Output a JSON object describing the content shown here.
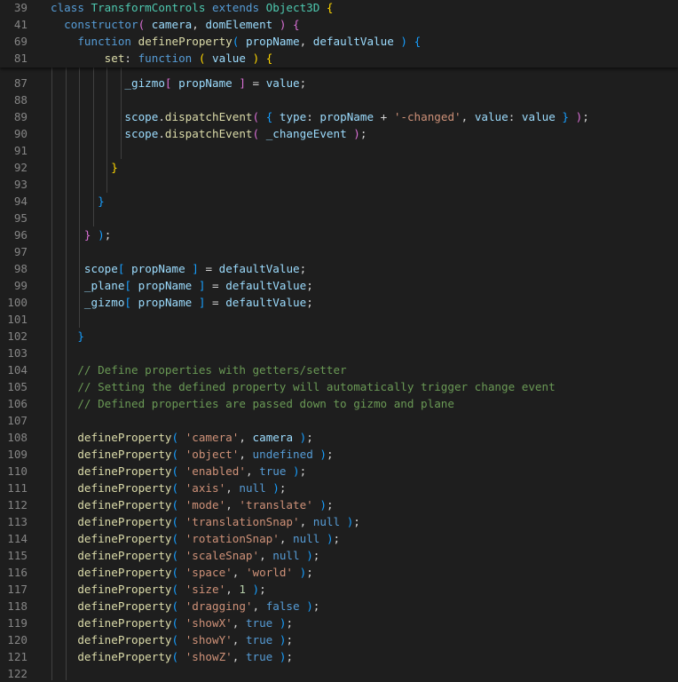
{
  "editor": {
    "sticky_lines": [
      {
        "num": "39",
        "tokens": [
          [
            "k",
            "class "
          ],
          [
            "cls",
            "TransformControls"
          ],
          [
            "k",
            " extends "
          ],
          [
            "cls",
            "Object3D"
          ],
          [
            "p",
            " "
          ],
          [
            "b1",
            "{"
          ]
        ]
      },
      {
        "num": "41",
        "tokens": [
          [
            "p",
            "  "
          ],
          [
            "k",
            "constructor"
          ],
          [
            "b2",
            "("
          ],
          [
            "p",
            " "
          ],
          [
            "v",
            "camera"
          ],
          [
            "p",
            ", "
          ],
          [
            "v",
            "domElement"
          ],
          [
            "p",
            " "
          ],
          [
            "b2",
            ")"
          ],
          [
            "p",
            " "
          ],
          [
            "b2",
            "{"
          ]
        ]
      },
      {
        "num": "69",
        "tokens": [
          [
            "p",
            "    "
          ],
          [
            "k",
            "function"
          ],
          [
            "p",
            " "
          ],
          [
            "fn",
            "defineProperty"
          ],
          [
            "b3",
            "("
          ],
          [
            "p",
            " "
          ],
          [
            "v",
            "propName"
          ],
          [
            "p",
            ", "
          ],
          [
            "v",
            "defaultValue"
          ],
          [
            "p",
            " "
          ],
          [
            "b3",
            ")"
          ],
          [
            "p",
            " "
          ],
          [
            "b3",
            "{"
          ]
        ]
      },
      {
        "num": "81",
        "tokens": [
          [
            "p",
            "        "
          ],
          [
            "fn",
            "set"
          ],
          [
            "p",
            ": "
          ],
          [
            "k",
            "function"
          ],
          [
            "p",
            " "
          ],
          [
            "b1",
            "("
          ],
          [
            "p",
            " "
          ],
          [
            "v",
            "value"
          ],
          [
            "p",
            " "
          ],
          [
            "b1",
            ")"
          ],
          [
            "p",
            " "
          ],
          [
            "b1",
            "{"
          ]
        ]
      }
    ],
    "lines": [
      {
        "num": "87",
        "tokens": [
          [
            "p",
            "           "
          ],
          [
            "v",
            "_gizmo"
          ],
          [
            "b2",
            "["
          ],
          [
            "p",
            " "
          ],
          [
            "v",
            "propName"
          ],
          [
            "p",
            " "
          ],
          [
            "b2",
            "]"
          ],
          [
            "p",
            " = "
          ],
          [
            "v",
            "value"
          ],
          [
            "p",
            ";"
          ]
        ]
      },
      {
        "num": "88",
        "tokens": []
      },
      {
        "num": "89",
        "tokens": [
          [
            "p",
            "           "
          ],
          [
            "v",
            "scope"
          ],
          [
            "p",
            "."
          ],
          [
            "fn",
            "dispatchEvent"
          ],
          [
            "b2",
            "("
          ],
          [
            "p",
            " "
          ],
          [
            "b3",
            "{"
          ],
          [
            "p",
            " "
          ],
          [
            "v",
            "type"
          ],
          [
            "p",
            ": "
          ],
          [
            "v",
            "propName"
          ],
          [
            "p",
            " + "
          ],
          [
            "s",
            "'-changed'"
          ],
          [
            "p",
            ", "
          ],
          [
            "v",
            "value"
          ],
          [
            "p",
            ": "
          ],
          [
            "v",
            "value"
          ],
          [
            "p",
            " "
          ],
          [
            "b3",
            "}"
          ],
          [
            "p",
            " "
          ],
          [
            "b2",
            ")"
          ],
          [
            "p",
            ";"
          ]
        ]
      },
      {
        "num": "90",
        "tokens": [
          [
            "p",
            "           "
          ],
          [
            "v",
            "scope"
          ],
          [
            "p",
            "."
          ],
          [
            "fn",
            "dispatchEvent"
          ],
          [
            "b2",
            "("
          ],
          [
            "p",
            " "
          ],
          [
            "v",
            "_changeEvent"
          ],
          [
            "p",
            " "
          ],
          [
            "b2",
            ")"
          ],
          [
            "p",
            ";"
          ]
        ]
      },
      {
        "num": "91",
        "tokens": []
      },
      {
        "num": "92",
        "tokens": [
          [
            "p",
            "         "
          ],
          [
            "b1",
            "}"
          ]
        ]
      },
      {
        "num": "93",
        "tokens": []
      },
      {
        "num": "94",
        "tokens": [
          [
            "p",
            "       "
          ],
          [
            "b3",
            "}"
          ]
        ]
      },
      {
        "num": "95",
        "tokens": []
      },
      {
        "num": "96",
        "tokens": [
          [
            "p",
            "     "
          ],
          [
            "b2",
            "}"
          ],
          [
            "p",
            " "
          ],
          [
            "b3",
            ")"
          ],
          [
            "p",
            ";"
          ]
        ]
      },
      {
        "num": "97",
        "tokens": []
      },
      {
        "num": "98",
        "tokens": [
          [
            "p",
            "     "
          ],
          [
            "v",
            "scope"
          ],
          [
            "b3",
            "["
          ],
          [
            "p",
            " "
          ],
          [
            "v",
            "propName"
          ],
          [
            "p",
            " "
          ],
          [
            "b3",
            "]"
          ],
          [
            "p",
            " = "
          ],
          [
            "v",
            "defaultValue"
          ],
          [
            "p",
            ";"
          ]
        ]
      },
      {
        "num": "99",
        "tokens": [
          [
            "p",
            "     "
          ],
          [
            "v",
            "_plane"
          ],
          [
            "b3",
            "["
          ],
          [
            "p",
            " "
          ],
          [
            "v",
            "propName"
          ],
          [
            "p",
            " "
          ],
          [
            "b3",
            "]"
          ],
          [
            "p",
            " = "
          ],
          [
            "v",
            "defaultValue"
          ],
          [
            "p",
            ";"
          ]
        ]
      },
      {
        "num": "100",
        "tokens": [
          [
            "p",
            "     "
          ],
          [
            "v",
            "_gizmo"
          ],
          [
            "b3",
            "["
          ],
          [
            "p",
            " "
          ],
          [
            "v",
            "propName"
          ],
          [
            "p",
            " "
          ],
          [
            "b3",
            "]"
          ],
          [
            "p",
            " = "
          ],
          [
            "v",
            "defaultValue"
          ],
          [
            "p",
            ";"
          ]
        ]
      },
      {
        "num": "101",
        "tokens": []
      },
      {
        "num": "102",
        "tokens": [
          [
            "p",
            "    "
          ],
          [
            "b3",
            "}"
          ]
        ]
      },
      {
        "num": "103",
        "tokens": []
      },
      {
        "num": "104",
        "tokens": [
          [
            "p",
            "    "
          ],
          [
            "c",
            "// Define properties with getters/setter"
          ]
        ]
      },
      {
        "num": "105",
        "tokens": [
          [
            "p",
            "    "
          ],
          [
            "c",
            "// Setting the defined property will automatically trigger change event"
          ]
        ]
      },
      {
        "num": "106",
        "tokens": [
          [
            "p",
            "    "
          ],
          [
            "c",
            "// Defined properties are passed down to gizmo and plane"
          ]
        ]
      },
      {
        "num": "107",
        "tokens": []
      },
      {
        "num": "108",
        "tokens": [
          [
            "p",
            "    "
          ],
          [
            "fn",
            "defineProperty"
          ],
          [
            "b3",
            "("
          ],
          [
            "p",
            " "
          ],
          [
            "s",
            "'camera'"
          ],
          [
            "p",
            ", "
          ],
          [
            "v",
            "camera"
          ],
          [
            "p",
            " "
          ],
          [
            "b3",
            ")"
          ],
          [
            "p",
            ";"
          ]
        ]
      },
      {
        "num": "109",
        "tokens": [
          [
            "p",
            "    "
          ],
          [
            "fn",
            "defineProperty"
          ],
          [
            "b3",
            "("
          ],
          [
            "p",
            " "
          ],
          [
            "s",
            "'object'"
          ],
          [
            "p",
            ", "
          ],
          [
            "k",
            "undefined"
          ],
          [
            "p",
            " "
          ],
          [
            "b3",
            ")"
          ],
          [
            "p",
            ";"
          ]
        ]
      },
      {
        "num": "110",
        "tokens": [
          [
            "p",
            "    "
          ],
          [
            "fn",
            "defineProperty"
          ],
          [
            "b3",
            "("
          ],
          [
            "p",
            " "
          ],
          [
            "s",
            "'enabled'"
          ],
          [
            "p",
            ", "
          ],
          [
            "k",
            "true"
          ],
          [
            "p",
            " "
          ],
          [
            "b3",
            ")"
          ],
          [
            "p",
            ";"
          ]
        ]
      },
      {
        "num": "111",
        "tokens": [
          [
            "p",
            "    "
          ],
          [
            "fn",
            "defineProperty"
          ],
          [
            "b3",
            "("
          ],
          [
            "p",
            " "
          ],
          [
            "s",
            "'axis'"
          ],
          [
            "p",
            ", "
          ],
          [
            "k",
            "null"
          ],
          [
            "p",
            " "
          ],
          [
            "b3",
            ")"
          ],
          [
            "p",
            ";"
          ]
        ]
      },
      {
        "num": "112",
        "tokens": [
          [
            "p",
            "    "
          ],
          [
            "fn",
            "defineProperty"
          ],
          [
            "b3",
            "("
          ],
          [
            "p",
            " "
          ],
          [
            "s",
            "'mode'"
          ],
          [
            "p",
            ", "
          ],
          [
            "s",
            "'translate'"
          ],
          [
            "p",
            " "
          ],
          [
            "b3",
            ")"
          ],
          [
            "p",
            ";"
          ]
        ]
      },
      {
        "num": "113",
        "tokens": [
          [
            "p",
            "    "
          ],
          [
            "fn",
            "defineProperty"
          ],
          [
            "b3",
            "("
          ],
          [
            "p",
            " "
          ],
          [
            "s",
            "'translationSnap'"
          ],
          [
            "p",
            ", "
          ],
          [
            "k",
            "null"
          ],
          [
            "p",
            " "
          ],
          [
            "b3",
            ")"
          ],
          [
            "p",
            ";"
          ]
        ]
      },
      {
        "num": "114",
        "tokens": [
          [
            "p",
            "    "
          ],
          [
            "fn",
            "defineProperty"
          ],
          [
            "b3",
            "("
          ],
          [
            "p",
            " "
          ],
          [
            "s",
            "'rotationSnap'"
          ],
          [
            "p",
            ", "
          ],
          [
            "k",
            "null"
          ],
          [
            "p",
            " "
          ],
          [
            "b3",
            ")"
          ],
          [
            "p",
            ";"
          ]
        ]
      },
      {
        "num": "115",
        "tokens": [
          [
            "p",
            "    "
          ],
          [
            "fn",
            "defineProperty"
          ],
          [
            "b3",
            "("
          ],
          [
            "p",
            " "
          ],
          [
            "s",
            "'scaleSnap'"
          ],
          [
            "p",
            ", "
          ],
          [
            "k",
            "null"
          ],
          [
            "p",
            " "
          ],
          [
            "b3",
            ")"
          ],
          [
            "p",
            ";"
          ]
        ]
      },
      {
        "num": "116",
        "tokens": [
          [
            "p",
            "    "
          ],
          [
            "fn",
            "defineProperty"
          ],
          [
            "b3",
            "("
          ],
          [
            "p",
            " "
          ],
          [
            "s",
            "'space'"
          ],
          [
            "p",
            ", "
          ],
          [
            "s",
            "'world'"
          ],
          [
            "p",
            " "
          ],
          [
            "b3",
            ")"
          ],
          [
            "p",
            ";"
          ]
        ]
      },
      {
        "num": "117",
        "tokens": [
          [
            "p",
            "    "
          ],
          [
            "fn",
            "defineProperty"
          ],
          [
            "b3",
            "("
          ],
          [
            "p",
            " "
          ],
          [
            "s",
            "'size'"
          ],
          [
            "p",
            ", "
          ],
          [
            "n",
            "1"
          ],
          [
            "p",
            " "
          ],
          [
            "b3",
            ")"
          ],
          [
            "p",
            ";"
          ]
        ]
      },
      {
        "num": "118",
        "tokens": [
          [
            "p",
            "    "
          ],
          [
            "fn",
            "defineProperty"
          ],
          [
            "b3",
            "("
          ],
          [
            "p",
            " "
          ],
          [
            "s",
            "'dragging'"
          ],
          [
            "p",
            ", "
          ],
          [
            "k",
            "false"
          ],
          [
            "p",
            " "
          ],
          [
            "b3",
            ")"
          ],
          [
            "p",
            ";"
          ]
        ]
      },
      {
        "num": "119",
        "tokens": [
          [
            "p",
            "    "
          ],
          [
            "fn",
            "defineProperty"
          ],
          [
            "b3",
            "("
          ],
          [
            "p",
            " "
          ],
          [
            "s",
            "'showX'"
          ],
          [
            "p",
            ", "
          ],
          [
            "k",
            "true"
          ],
          [
            "p",
            " "
          ],
          [
            "b3",
            ")"
          ],
          [
            "p",
            ";"
          ]
        ]
      },
      {
        "num": "120",
        "tokens": [
          [
            "p",
            "    "
          ],
          [
            "fn",
            "defineProperty"
          ],
          [
            "b3",
            "("
          ],
          [
            "p",
            " "
          ],
          [
            "s",
            "'showY'"
          ],
          [
            "p",
            ", "
          ],
          [
            "k",
            "true"
          ],
          [
            "p",
            " "
          ],
          [
            "b3",
            ")"
          ],
          [
            "p",
            ";"
          ]
        ]
      },
      {
        "num": "121",
        "tokens": [
          [
            "p",
            "    "
          ],
          [
            "fn",
            "defineProperty"
          ],
          [
            "b3",
            "("
          ],
          [
            "p",
            " "
          ],
          [
            "s",
            "'showZ'"
          ],
          [
            "p",
            ", "
          ],
          [
            "k",
            "true"
          ],
          [
            "p",
            " "
          ],
          [
            "b3",
            ")"
          ],
          [
            "p",
            ";"
          ]
        ]
      },
      {
        "num": "122",
        "tokens": []
      }
    ]
  }
}
